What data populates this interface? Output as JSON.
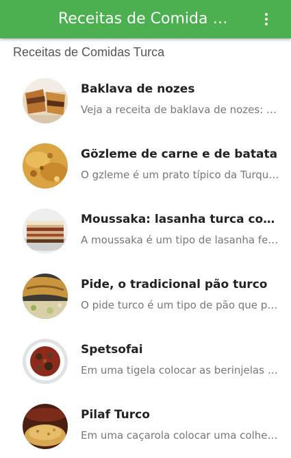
{
  "app_bar": {
    "title": "Receitas de Comida Turca",
    "menu_icon": "more-vert-icon",
    "color": "#4caf50"
  },
  "subheader": "Receitas de Comidas Turca",
  "recipes": [
    {
      "title": "Baklava de nozes",
      "description": "Veja a receita de baklava de nozes: desfrute desta delícia turca",
      "image": "baklava-photo"
    },
    {
      "title": "Gözleme de carne e de batata",
      "description": "O gzleme é um prato típico da Turquia feito com massa fina",
      "image": "gozleme-photo"
    },
    {
      "title": "Moussaka: lasanha turca com carne",
      "description": "A moussaka é um tipo de lasanha feita com berinjela",
      "image": "moussaka-photo"
    },
    {
      "title": "Pide, o tradicional pão turco",
      "description": "O pide turco é um tipo de pão que pode ser recheado",
      "image": "pide-photo"
    },
    {
      "title": "Spetsofai",
      "description": "Em uma tigela colocar as berinjelas cortadas em cubos",
      "image": "spetsofai-photo"
    },
    {
      "title": "Pilaf Turco",
      "description": "Em uma caçarola colocar uma colher de manteiga",
      "image": "pilaf-photo"
    }
  ]
}
